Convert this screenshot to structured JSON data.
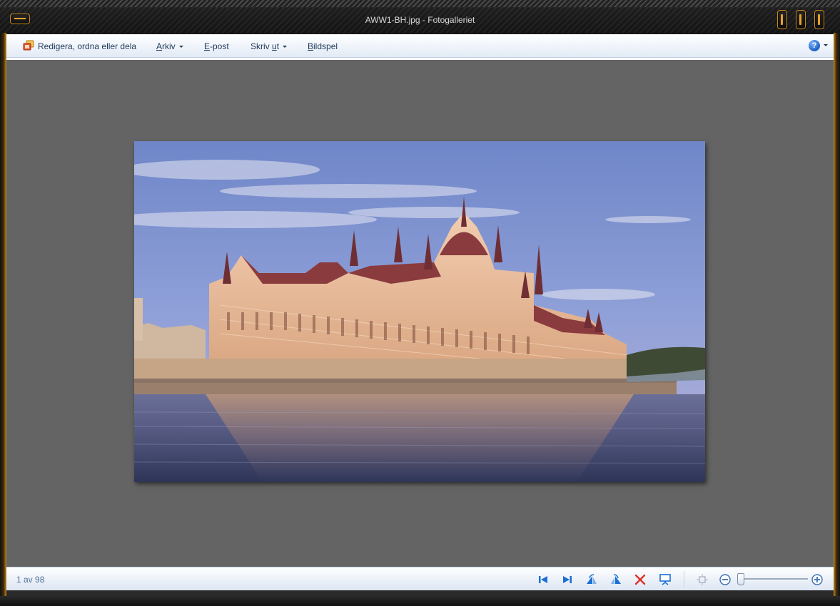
{
  "window": {
    "title": "AWW1-BH.jpg - Fotogalleriet"
  },
  "menubar": {
    "edit_label": "Redigera, ordna eller dela",
    "arkiv": {
      "first": "A",
      "rest": "rkiv"
    },
    "epost": {
      "first": "E",
      "rest": "-post"
    },
    "skriv": {
      "prefix": "Skriv ",
      "u": "u",
      "rest": "t"
    },
    "bildspel": {
      "first": "B",
      "rest": "ildspel"
    },
    "help_symbol": "?"
  },
  "status": {
    "counter": "1 av 98",
    "zoom_level": 0.05
  },
  "icons": {
    "edit": "photo-edit-icon",
    "help": "help-icon",
    "prev": "previous-icon",
    "next": "next-icon",
    "rotate_left": "rotate-left-icon",
    "rotate_right": "rotate-right-icon",
    "delete": "delete-icon",
    "slideshow": "slideshow-icon",
    "actual_size": "actual-size-icon",
    "zoom_out": "zoom-out-icon",
    "zoom_in": "zoom-in-icon"
  },
  "colors": {
    "accent": "#c8871a",
    "toolbar_text": "#1e395b",
    "viewer_bg": "#646464",
    "nav_blue": "#1a6fd4",
    "delete_red": "#e0302a"
  }
}
